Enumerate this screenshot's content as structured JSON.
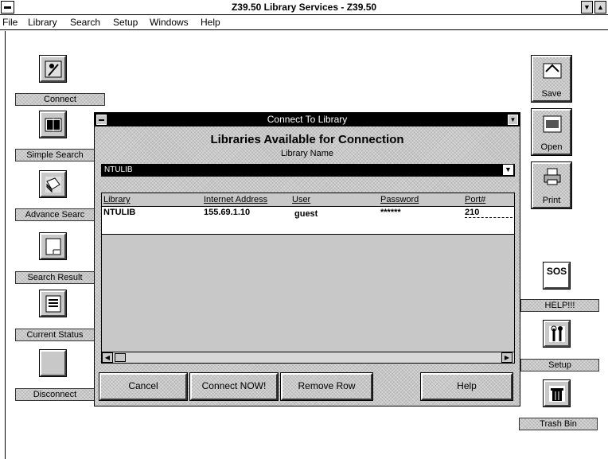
{
  "window": {
    "title": "Z39.50 Library Services - Z39.50",
    "minimize_glyph": "▼",
    "maximize_glyph": "▲"
  },
  "menu": {
    "file": "File",
    "library": "Library",
    "search": "Search",
    "setup": "Setup",
    "windows": "Windows",
    "help": "Help"
  },
  "left_tools": {
    "connect": "Connect",
    "simple_search": "Simple Search",
    "advance_search": "Advance Searc",
    "search_result": "Search Result",
    "current_status": "Current Status",
    "disconnect": "Disconnect"
  },
  "right_tools": {
    "save": "Save",
    "open": "Open",
    "print": "Print",
    "help": "HELP!!!",
    "setup": "Setup",
    "trash": "Trash Bin",
    "sos": "SOS"
  },
  "dialog": {
    "title": "Connect To Library",
    "heading": "Libraries Available for Connection",
    "library_name_label": "Library Name",
    "selected_library": "NTULIB",
    "columns": {
      "library": "Library",
      "internet_address": "Internet Address",
      "user": "User",
      "password": "Password",
      "port": "Port#"
    },
    "row": {
      "library": "NTULIB",
      "internet_address": "155.69.1.10",
      "user": "guest",
      "password": "******",
      "port": "210"
    },
    "buttons": {
      "cancel": "Cancel",
      "connect": "Connect NOW!",
      "remove_row": "Remove Row",
      "help": "Help"
    }
  }
}
